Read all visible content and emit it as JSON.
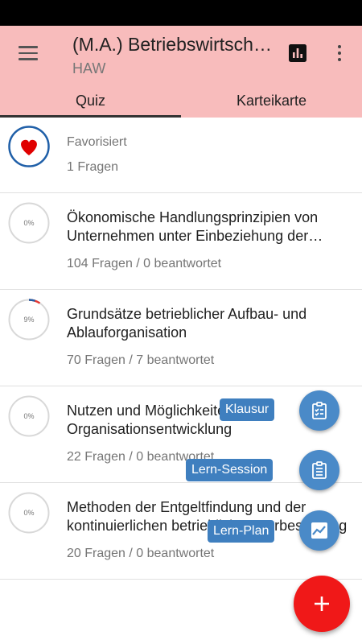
{
  "app_bar": {
    "title": "(M.A.) Betriebswirtschaftslehre",
    "subtitle": "HAW",
    "menu_icon": "hamburger-menu-icon",
    "stats_icon": "bar-chart-icon",
    "more_icon": "more-vertical-icon",
    "background": "#f8bcbc"
  },
  "tabs": [
    {
      "label": "Quiz",
      "active": true
    },
    {
      "label": "Karteikarte",
      "active": false
    }
  ],
  "items": [
    {
      "title": "Favorisiert",
      "sub": "1 Fragen",
      "icon": "heart-icon",
      "progress": null
    },
    {
      "title": "Ökonomische Handlungsprinzipien von Unternehmen unter Einbeziehung der ethischen Dimension",
      "sub": "104 Fragen / 0 beantwortet",
      "pct": "0%",
      "progress": 0
    },
    {
      "title": "Grundsätze betrieblicher Aufbau- und Ablauforganisation",
      "sub": "70 Fragen / 7 beantwortet",
      "pct": "9%",
      "progress": 0.09
    },
    {
      "title": "Nutzen und Möglichkeiten der Organisationsentwicklung",
      "sub": "22 Fragen / 0 beantwortet",
      "pct": "0%",
      "progress": 0
    },
    {
      "title": "Methoden der Entgeltfindung und der kontinuierlichen betrieblichen Verbesserung",
      "sub": "20 Fragen / 0 beantwortet",
      "pct": "0%",
      "progress": 0
    }
  ],
  "fab_menu": {
    "klausur": {
      "label": "Klausur",
      "icon": "clipboard-checklist-icon"
    },
    "lern_session": {
      "label": "Lern-Session",
      "icon": "clipboard-list-icon"
    },
    "lern_plan": {
      "label": "Lern-Plan",
      "icon": "trending-chart-icon"
    },
    "main": {
      "icon": "plus-icon",
      "color": "#f01818"
    },
    "mini_color": "#4a8ac8"
  }
}
